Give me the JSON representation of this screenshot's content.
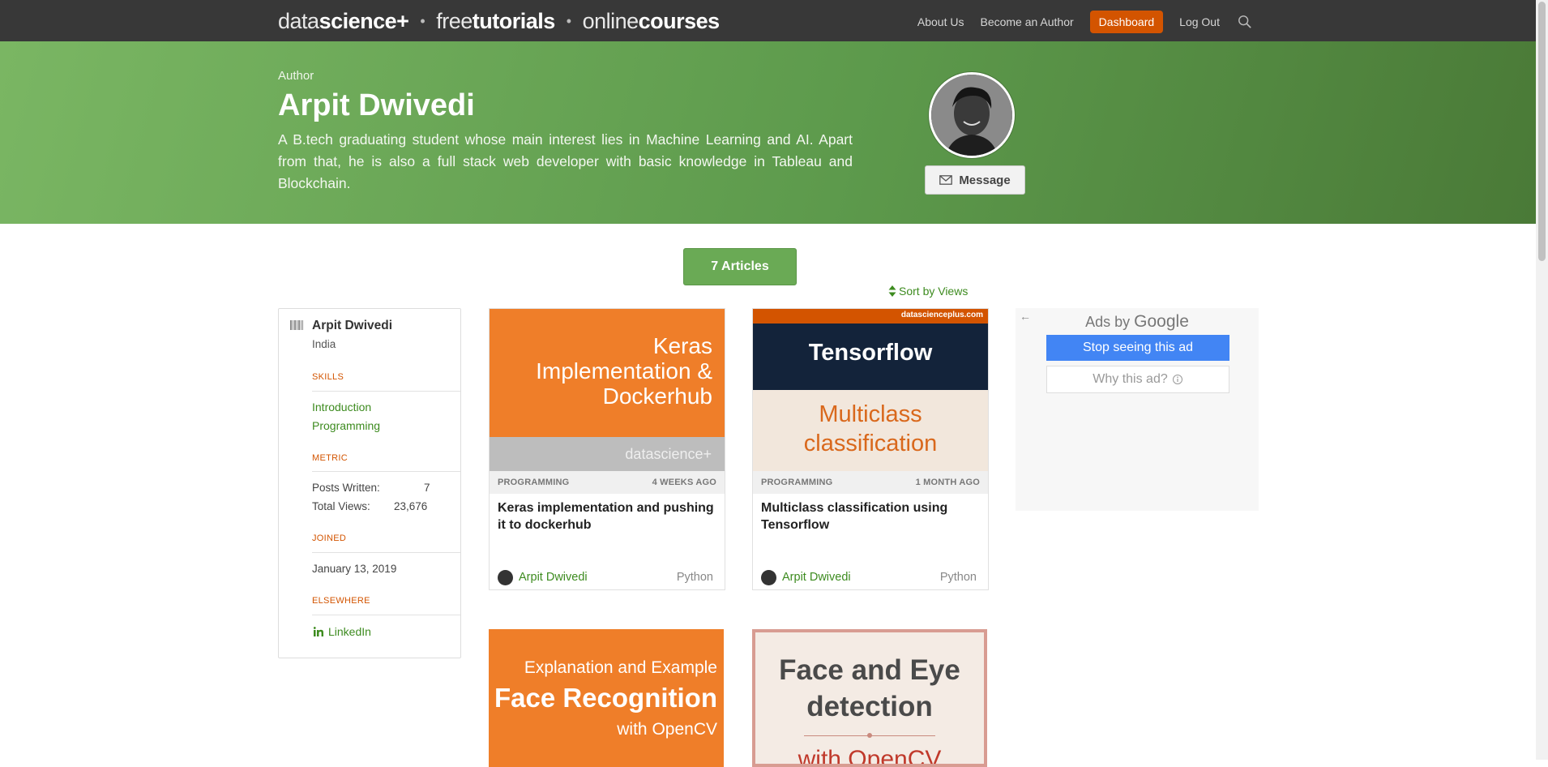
{
  "nav": {
    "logo": {
      "part1_thin": "data",
      "part1_bold": "science+",
      "part2_thin": "free",
      "part2_bold": "tutorials",
      "part3_thin": "online",
      "part3_bold": "courses",
      "separator": "•"
    },
    "links": [
      "About Us",
      "Become an Author"
    ],
    "dashboard_label": "Dashboard",
    "logout_label": "Log Out",
    "icons": {
      "search": "search-icon"
    }
  },
  "hero": {
    "kicker": "Author",
    "name": "Arpit Dwivedi",
    "bio": "A B.tech graduating student whose main interest lies in Machine Learning and AI. Apart from that, he is also a full stack web developer with basic knowledge in Tableau and Blockchain.",
    "message_label": "Message"
  },
  "articles_button": "7 Articles",
  "sort_label": "Sort by Views",
  "profile": {
    "name": "Arpit Dwivedi",
    "country": "India",
    "skills_head": "SKILLS",
    "skills": [
      "Introduction",
      "Programming"
    ],
    "metric_head": "METRIC",
    "posts_label": "Posts Written:",
    "posts_value": "7",
    "views_label": "Total Views:",
    "views_value": "23,676",
    "joined_head": "JOINED",
    "joined_value": "January 13, 2019",
    "elsewhere_head": "ELSEWHERE",
    "linkedin_label": "LinkedIn"
  },
  "cards": [
    {
      "banner_line1": "Keras",
      "banner_line2": "Implementation &",
      "banner_line3": "Dockerhub",
      "banner_brand": "datascience+",
      "category": "PROGRAMMING",
      "age": "4 WEEKS AGO",
      "title": "Keras implementation and pushing it to dockerhub",
      "author": "Arpit Dwivedi",
      "tag": "Python"
    },
    {
      "banner_top": "datascienceplus.com",
      "banner_line1": "Tensorflow",
      "banner_line2": "Multiclass",
      "banner_line3": "classification",
      "category": "PROGRAMMING",
      "age": "1 MONTH AGO",
      "title": "Multiclass classification using Tensorflow",
      "author": "Arpit Dwivedi",
      "tag": "Python"
    },
    {
      "banner_line1": "Explanation and Example",
      "banner_line2": "Face Recognition",
      "banner_line3": "with OpenCV"
    },
    {
      "banner_line1": "Face and Eye",
      "banner_line2": "detection",
      "banner_line3": "with OpenCV"
    }
  ],
  "ad": {
    "back": "←",
    "ads_by": "Ads by",
    "google": "Google",
    "stop": "Stop seeing this ad",
    "why": "Why this ad?"
  },
  "colors": {
    "accent_green": "#3d8b1f",
    "orange": "#d35400",
    "hero_green": "#6aaa55"
  }
}
